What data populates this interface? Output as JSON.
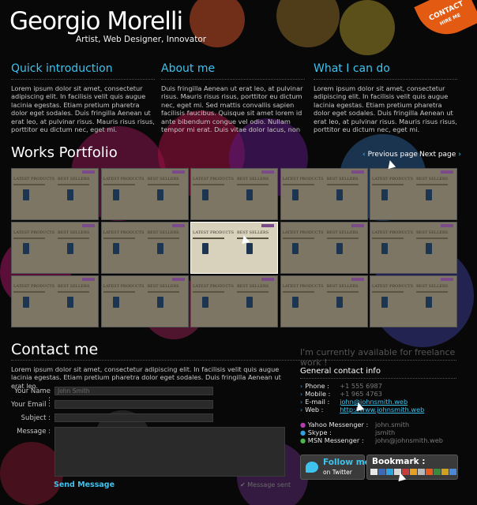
{
  "header": {
    "name": "Georgio Morelli",
    "tagline": "Artist, Web Designer, Innovator",
    "contact_badge": "CONTACT",
    "badge_sub": "HIRE ME"
  },
  "intro": {
    "quick": {
      "title": "Quick introduction",
      "text": "Lorem ipsum dolor sit amet, consectetur adipiscing elit. In facilisis velit quis augue lacinia egestas. Etiam pretium pharetra dolor eget sodales. Duis fringilla Aenean ut erat leo, at pulvinar risus. Mauris risus risus, porttitor eu dictum nec, eget mi."
    },
    "about": {
      "title": "About me",
      "text": "Duis fringilla Aenean ut erat leo, at pulvinar risus. Mauris risus risus, porttitor eu dictum nec, eget mi. Sed mattis convallis sapien facilisis faucibus. Quisque sit amet lorem id ante bibendum congue vel odio. Nullam tempor mi erat. Duis vitae dolor lacus, non"
    },
    "can": {
      "title": "What I can do",
      "text": "Lorem ipsum dolor sit amet, consectetur adipiscing elit. In facilisis velit quis augue lacinia egestas. Etiam pretium pharetra dolor eget sodales. Duis fringilla Aenean ut erat leo, at pulvinar risus. Mauris risus risus, porttitor eu dictum nec, eget mi."
    }
  },
  "portfolio": {
    "title": "Works Portfolio",
    "prev": "Previous page",
    "next": "Next page",
    "thumb_h1": "LATEST PRODUCTS",
    "thumb_h2": "BEST SELLERS"
  },
  "contact": {
    "title": "Contact me",
    "availability": "I'm currently available for freelance work !",
    "intro": "Lorem ipsum dolor sit amet, consectetur adipiscing elit. In facilisis velit quis augue lacinia egestas. Etiam pretium pharetra dolor eget sodales. Duis fringilla Aenean ut erat leo.",
    "form": {
      "name_label": "Your Name :",
      "name_placeholder": "John Smith",
      "email_label": "Your Email :",
      "subject_label": "Subject :",
      "message_label": "Message :",
      "send": "Send Message",
      "sent": "Message sent"
    },
    "info": {
      "title": "General contact info",
      "phone_k": "Phone :",
      "phone_v": "+1 555 6987",
      "mobile_k": "Mobile :",
      "mobile_v": "+1 965 4763",
      "email_k": "E-mail :",
      "email_v": "john@johnsmith.web",
      "web_k": "Web :",
      "web_v": "http://www.johnsmith.web",
      "yahoo_k": "Yahoo Messenger :",
      "yahoo_v": "john.smith",
      "skype_k": "Skype :",
      "skype_v": "jsmith",
      "msn_k": "MSN Messenger :",
      "msn_v": "john@johnsmith.web"
    },
    "follow": {
      "line1": "Follow me",
      "line2": "on Twitter"
    },
    "bookmark": "Bookmark :"
  },
  "colors": {
    "accent": "#3ec3ef",
    "badge": "#e35b12"
  }
}
